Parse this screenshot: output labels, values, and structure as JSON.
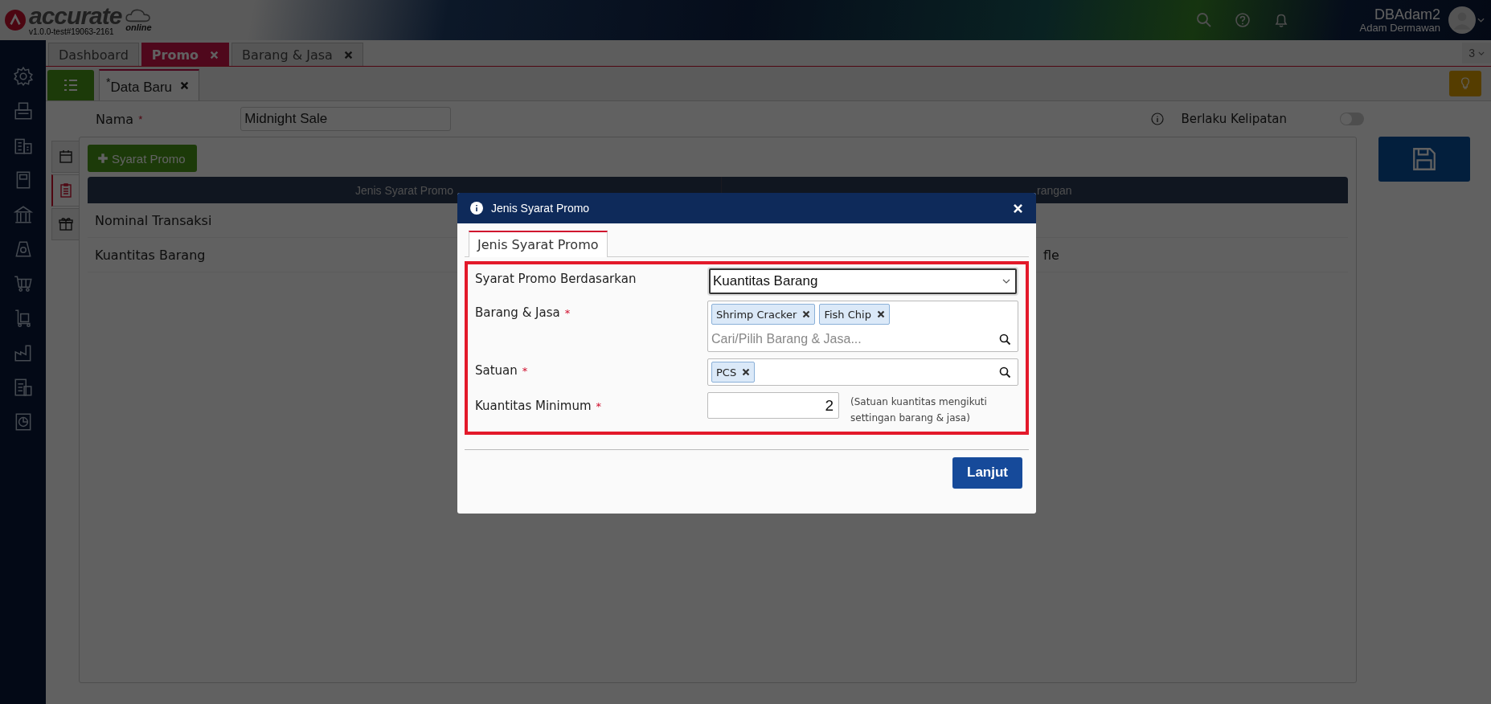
{
  "header": {
    "logo": "accurate",
    "logo_sub": "online",
    "version": "v1.0.0-test#19063-2161",
    "user": "DBAdam2",
    "user_name": "Adam Dermawan"
  },
  "tabs": [
    {
      "label": "Dashboard",
      "selected": false
    },
    {
      "label": "Promo",
      "selected": true
    },
    {
      "label": "Barang & Jasa",
      "selected": false
    }
  ],
  "tab_count": "3",
  "subtabs": [
    {
      "label": "$^{*}$Data Baru",
      "selected": true
    }
  ],
  "form": {
    "name_label": "Nama",
    "name_mark": "*",
    "name_value": "Midnight Sale",
    "toggle_label": "Berlaku Kelipatan",
    "toggle_on": false
  },
  "side_tabs": [
    {
      "selected": false
    },
    {
      "selected": true
    },
    {
      "selected": false
    }
  ],
  "add_button": "Syarat Promo",
  "table": {
    "columns": [
      "Jenis Syarat Promo",
      "rangan"
    ],
    "rows": [
      {
        "column_1": "Nominal Transaksi"
      },
      {
        "column_1": "Kuantitas Barang",
        "column_2": "fle"
      }
    ]
  },
  "modal": {
    "title": "Jenis Syarat Promo",
    "tab": "Jenis Syarat Promo",
    "fields": [
      {
        "kind": "select",
        "label": "Syarat Promo Berdasarkan",
        "value": "Kuantitas Barang"
      },
      {
        "kind": "tags",
        "label": "Barang & Jasa",
        "mark": "*",
        "tags": [
          "Shrimp Cracker",
          "Fish Chip"
        ],
        "placeholder": "Cari/Pilih Barang & Jasa..."
      },
      {
        "kind": "tags",
        "label": "Satuan",
        "mark": "*",
        "tags": [
          "PCS"
        ]
      },
      {
        "kind": "number",
        "label": "Kuantitas Minimum",
        "mark": "*",
        "value": "2",
        "note": "(Satuan kuantitas mengikuti settingan barang & jasa)"
      }
    ],
    "button": "Lanjut"
  }
}
